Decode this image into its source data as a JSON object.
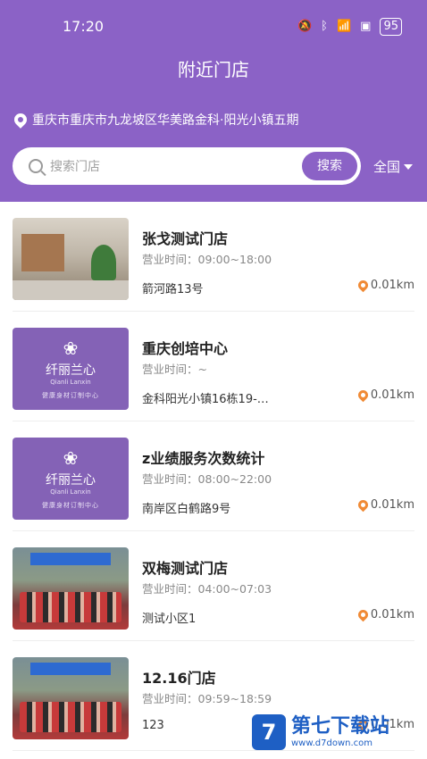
{
  "status_bar": {
    "time": "17:20",
    "battery": "95",
    "icons": [
      "mute-icon",
      "bluetooth-icon",
      "wifi-icon",
      "sim-icon",
      "battery-icon"
    ]
  },
  "header": {
    "title": "附近门店",
    "location": "重庆市重庆市九龙坡区华美路金科·阳光小镇五期",
    "search_placeholder": "搜索门店",
    "search_button": "搜索",
    "region": "全国"
  },
  "stores": [
    {
      "name": "张戈测试门店",
      "hours": "营业时间：09:00~18:00",
      "address": "箭河路13号",
      "distance": "0.01km",
      "thumb": "room"
    },
    {
      "name": "重庆创培中心",
      "hours": "营业时间：~",
      "address": "金科阳光小镇16栋19-…",
      "distance": "0.01km",
      "thumb": "logo"
    },
    {
      "name": "z业绩服务次数统计",
      "hours": "营业时间：08:00~22:00",
      "address": "南岸区白鹤路9号",
      "distance": "0.01km",
      "thumb": "logo"
    },
    {
      "name": "双梅测试门店",
      "hours": "营业时间：04:00~07:03",
      "address": "测试小区1",
      "distance": "0.01km",
      "thumb": "crowd"
    },
    {
      "name": "12.16门店",
      "hours": "营业时间：09:59~18:59",
      "address": "123",
      "distance": "0.01km",
      "thumb": "crowd"
    }
  ],
  "logo_thumb": {
    "brand": "纤丽兰心",
    "brand_sub": "Qianli Lanxin",
    "tagline": "健康身材订制中心"
  },
  "watermark": {
    "big": "第七下载站",
    "small": "www.d7down.com"
  },
  "colors": {
    "accent": "#8b62c6",
    "distance_pin": "#f08a35"
  }
}
